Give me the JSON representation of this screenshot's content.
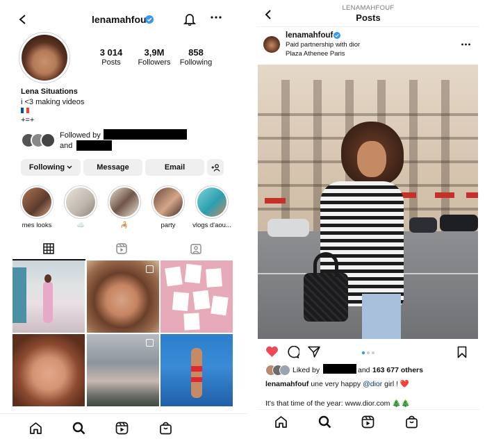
{
  "profile": {
    "username": "lenamahfouf",
    "stats": [
      {
        "value": "3 014",
        "label": "Posts"
      },
      {
        "value": "3,9M",
        "label": "Followers"
      },
      {
        "value": "858",
        "label": "Following"
      }
    ],
    "name": "Lena Situations",
    "bio_line1": "i <3 making videos",
    "bio_flag": "🇫🇷",
    "bio_line3": "+=+",
    "followed_by": "Followed by",
    "and_text": "and",
    "buttons": {
      "following": "Following",
      "message": "Message",
      "email": "Email"
    },
    "highlights": [
      {
        "label": "mes looks"
      },
      {
        "label": "☁️"
      },
      {
        "label": "🦂"
      },
      {
        "label": "party"
      },
      {
        "label": "vlogs d'aou..."
      }
    ]
  },
  "post": {
    "header_username": "LENAMAHFOUF",
    "header_title": "Posts",
    "username": "lenamahfouf",
    "sponsor": "Paid partnership with dior",
    "location": "Plaza Athenee Paris",
    "liked_by": "Liked by",
    "likes_count": "163 677 others",
    "and_text": "and",
    "caption_user": "lenamahfouf",
    "caption_text": "une very happy",
    "caption_mention": "@dior",
    "caption_end": "girl ! ❤️",
    "caption_line2": "It's that time of the year: www.dior.com 🎄🎄"
  },
  "colors": {
    "verified": "#3897f0",
    "like_red": "#ed4956",
    "link_blue": "#00376b"
  }
}
